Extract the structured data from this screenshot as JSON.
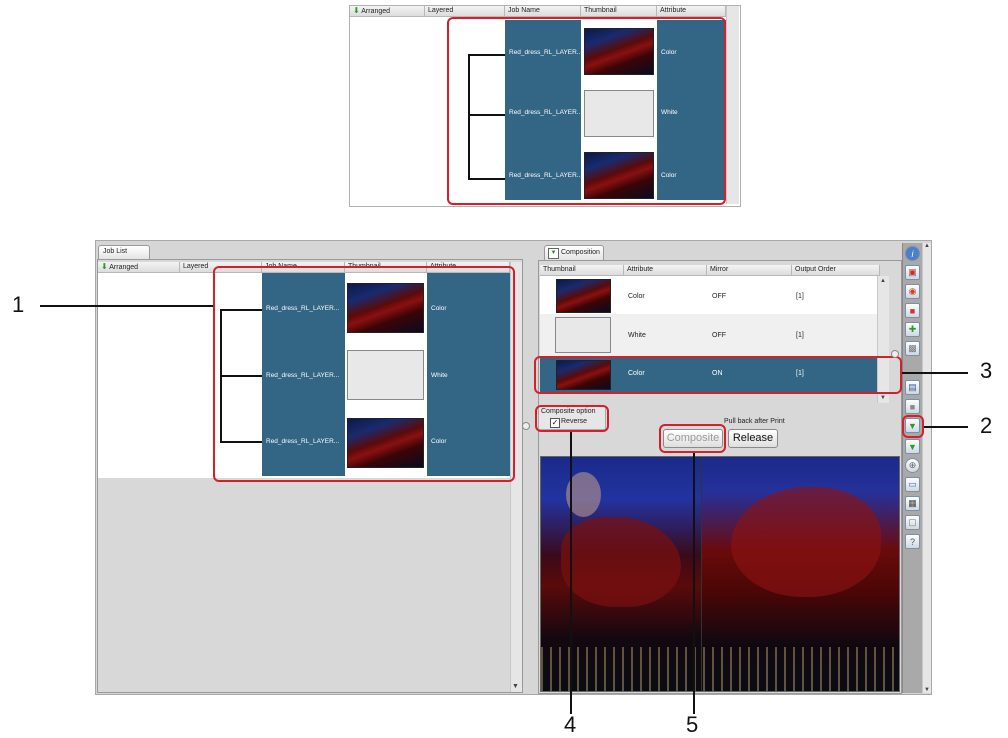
{
  "inset": {
    "columns": [
      "Arranged",
      "Layered",
      "Job Name",
      "Thumbnail",
      "Attribute"
    ],
    "rows": [
      {
        "name": "Red_dress_RL_LAYER...",
        "attribute": "Color"
      },
      {
        "name": "Red_dress_RL_LAYER...",
        "attribute": "White"
      },
      {
        "name": "Red_dress_RL_LAYER...",
        "attribute": "Color"
      }
    ]
  },
  "job_list": {
    "tab_label": "Job List",
    "columns": [
      "Arranged",
      "Layered",
      "Job Name",
      "Thumbnail",
      "Attribute"
    ],
    "rows": [
      {
        "name": "Red_dress_RL_LAYER...",
        "attribute": "Color"
      },
      {
        "name": "Red_dress_RL_LAYER...",
        "attribute": "White"
      },
      {
        "name": "Red_dress_RL_LAYER...",
        "attribute": "Color"
      }
    ]
  },
  "composition": {
    "tab_label": "Composition",
    "columns": [
      "Thumbnail",
      "Attribute",
      "Mirror",
      "Output Order"
    ],
    "rows": [
      {
        "attribute": "Color",
        "mirror": "OFF",
        "order": "[1]"
      },
      {
        "attribute": "White",
        "mirror": "OFF",
        "order": "[1]"
      },
      {
        "attribute": "Color",
        "mirror": "ON",
        "order": "[1]"
      }
    ],
    "composite_option_label": "Composite option",
    "reverse_label": "Reverse",
    "pullback_label": "Pull back after Print",
    "composite_button": "Composite",
    "release_button": "Release"
  },
  "callouts": [
    "1",
    "2",
    "3",
    "4",
    "5"
  ],
  "colors": {
    "row_selected": "#336585",
    "highlight": "#d4202a"
  }
}
